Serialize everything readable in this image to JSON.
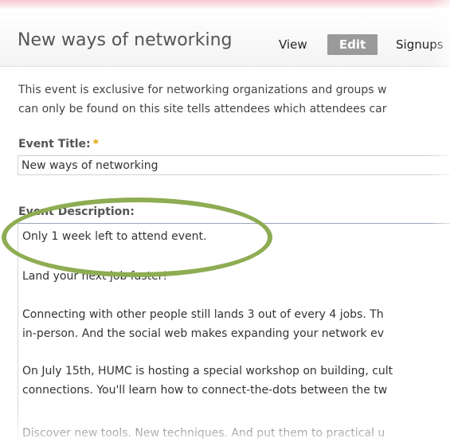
{
  "header": {
    "title": "New ways of networking",
    "tabs": [
      {
        "label": "View",
        "active": false
      },
      {
        "label": "Edit",
        "active": true
      },
      {
        "label": "Signups",
        "active": false
      }
    ]
  },
  "intro": {
    "line1": "This event is exclusive for networking organizations and groups w",
    "line2": "can only be found on this site tells attendees which attendees car"
  },
  "form": {
    "title_label": "Event Title:",
    "required_mark": "*",
    "title_value": "New ways of networking",
    "description_label": "Event Description:",
    "description_lines": [
      "Only 1 week left to attend event.",
      "",
      "Land your next job faster!",
      "",
      "Connecting with other people still lands 3 out of every 4 jobs.  Th",
      "in-person.  And the social web makes expanding your network ev",
      "",
      "On July 15th, HUMC is hosting a special workshop on building, cult",
      "connections.  You'll learn how to connect-the-dots between the tw",
      "",
      "Discover new tools.  New techniques.  And put them to practical u"
    ]
  },
  "colors": {
    "highlight_oval": "#8eac52",
    "active_tab_bg": "#9a9a9a",
    "required_star": "#e0a000"
  }
}
